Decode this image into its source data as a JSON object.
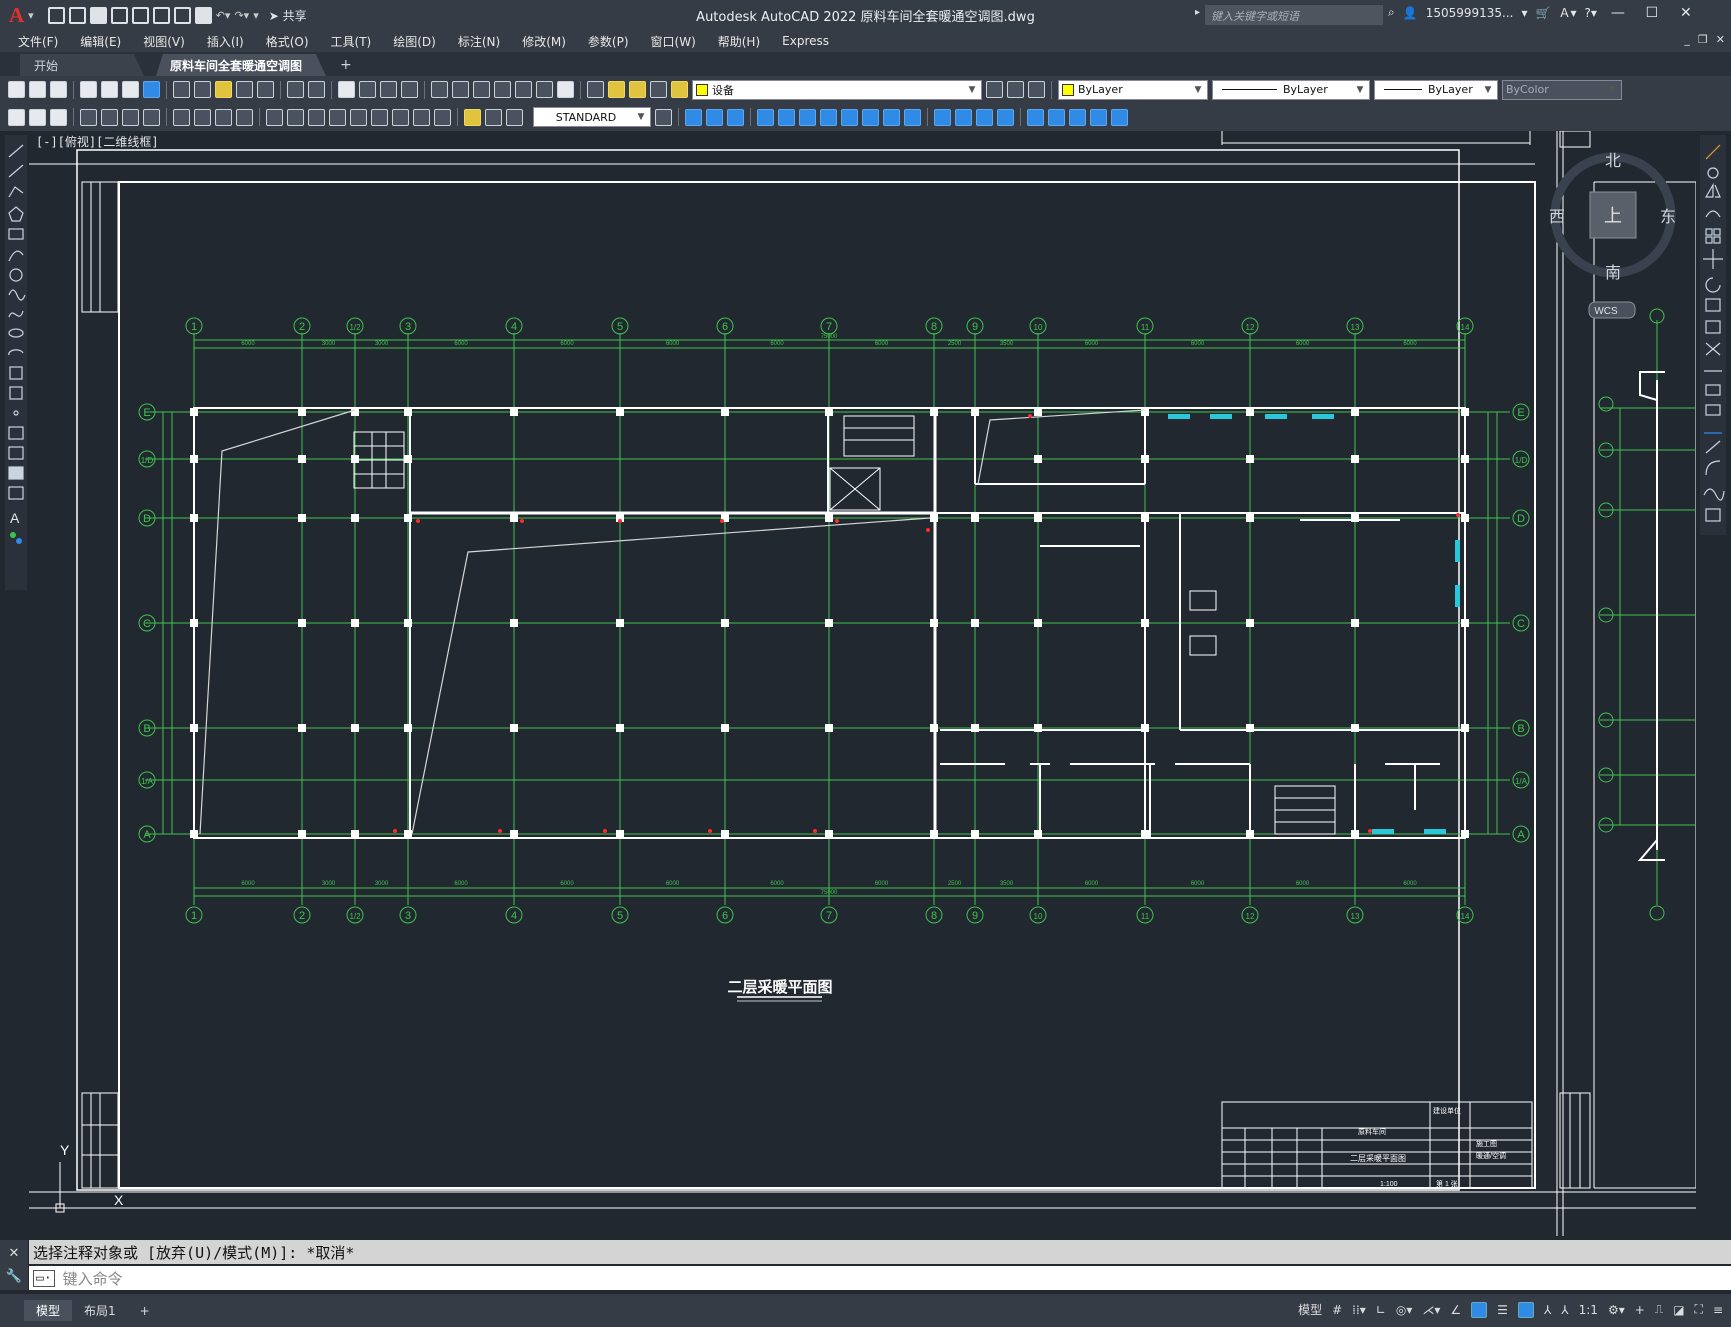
{
  "app": {
    "title": "Autodesk AutoCAD 2022    原料车间全套暖通空调图.dwg",
    "search_placeholder": "键入关键字或短语",
    "user": "1505999135...",
    "share_label": "共享"
  },
  "menus": [
    "文件(F)",
    "编辑(E)",
    "视图(V)",
    "插入(I)",
    "格式(O)",
    "工具(T)",
    "绘图(D)",
    "标注(N)",
    "修改(M)",
    "参数(P)",
    "窗口(W)",
    "帮助(H)",
    "Express"
  ],
  "tabs": {
    "home": "开始",
    "active": "原料车间全套暖通空调图*",
    "close": "✕",
    "add": "+"
  },
  "toolbar": {
    "layer": "设备",
    "color": "ByLayer",
    "linetype": "ByLayer",
    "lineweight": "ByLayer",
    "plotstyle": "ByColor",
    "textstyle": "STANDARD"
  },
  "viewport": {
    "label": "[-][俯视][二维线框]"
  },
  "viewcube": {
    "north": "北",
    "south": "南",
    "east": "东",
    "west": "西",
    "top": "上",
    "wcs": "WCS"
  },
  "drawing": {
    "plan_title": "二层采暖平面图",
    "grid_cols": [
      "1",
      "2",
      "1/2",
      "3",
      "4",
      "5",
      "6",
      "7",
      "8",
      "9",
      "10",
      "11",
      "12",
      "13",
      "14"
    ],
    "grid_rows": [
      "E",
      "1/D",
      "D",
      "C",
      "B",
      "1/A",
      "A"
    ],
    "dims_top": [
      "6000",
      "3000",
      "3000",
      "6000",
      "6000",
      "6000",
      "6000",
      "6000",
      "2500",
      "3500",
      "6000",
      "6000",
      "6000",
      "6000"
    ],
    "total_dim": "75000",
    "titleblock": {
      "lead": "建设单位",
      "project": "原料车间",
      "drawing_name": "二层采暖平面图",
      "stage": "施工图",
      "disc": "暖通/空调",
      "scale": "1:100",
      "sheet": "第 1 张"
    }
  },
  "axis_labels": {
    "y": "Y",
    "x": "X"
  },
  "command": {
    "history": "选择注释对象或 [放弃(U)/模式(M)]: *取消*",
    "prompt": "键入命令",
    "icon": "▭·"
  },
  "status": {
    "model_tab": "模型",
    "layout_tab": "布局1",
    "add": "+",
    "model_btn": "模型",
    "scale": "1:1"
  }
}
